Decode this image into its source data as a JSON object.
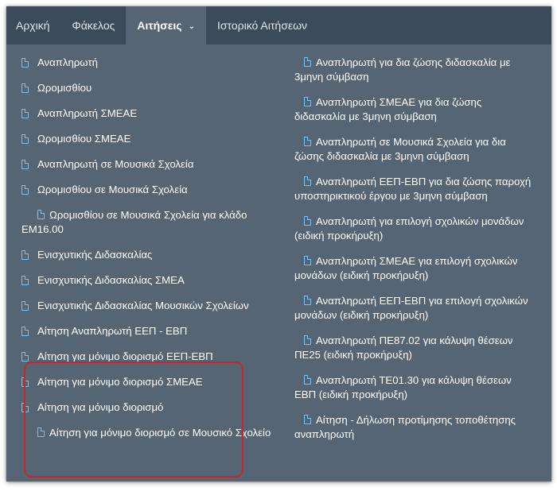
{
  "nav": {
    "items": [
      {
        "label": "Αρχική"
      },
      {
        "label": "Φάκελος"
      },
      {
        "label": "Αιτήσεις",
        "caret": "⌄"
      },
      {
        "label": "Ιστορικό Αιτήσεων"
      }
    ]
  },
  "menu": {
    "left": [
      "Αναπληρωτή",
      "Ωρομισθίου",
      "Αναπληρωτή ΣΜΕΑΕ",
      "Ωρομισθίου ΣΜΕΑΕ",
      "Αναπληρωτή σε Μουσικά Σχολεία",
      "Ωρομισθίου σε Μουσικά Σχολεία",
      "Ωρομισθίου σε Μουσικά Σχολεία για κλάδο ΕΜ16.00",
      "Ενισχυτικής Διδασκαλίας",
      "Ενισχυτικής Διδασκαλίας ΣΜΕΑ",
      "Ενισχυτικής Διδασκαλίας Μουσικών Σχολείων",
      "Αίτηση Αναπληρωτή ΕΕΠ - ΕΒΠ",
      "Αίτηση για μόνιμο διορισμό ΕΕΠ-ΕΒΠ",
      "Αίτηση για μόνιμο διορισμό ΣΜΕΑΕ",
      "Αίτηση για μόνιμο διορισμό",
      "Αίτηση για μόνιμο διορισμό σε Μουσικό Σχολείο"
    ],
    "right": [
      "Αναπληρωτή για δια ζώσης διδασκαλία με 3μηνη σύμβαση",
      "Αναπληρωτή ΣΜΕΑΕ για δια ζώσης διδασκαλία με 3μηνη σύμβαση",
      "Αναπληρωτή σε Μουσικά Σχολεία για δια ζώσης διδασκαλία με 3μηνη σύμβαση",
      "Αναπληρωτή ΕΕΠ-ΕΒΠ για δια ζώσης παροχή υποστηρικτικού έργου με 3μηνη σύμβαση",
      "Αναπληρωτή για επιλογή σχολικών μονάδων (ειδική προκήρυξη)",
      "Αναπληρωτή ΣΜΕΑΕ για επιλογή σχολικών μονάδων (ειδική προκήρυξη)",
      "Αναπληρωτή ΕΕΠ-ΕΒΠ για επιλογή σχολικών μονάδων (ειδική προκήρυξη)",
      "Αναπληρωτή ΠΕ87.02 για κάλυψη θέσεων ΠΕ25 (ειδική προκήρυξη)",
      "Αναπληρωτή ΤΕ01.30 για κάλυψη θέσεων ΕΒΠ (ειδική προκήρυξη)",
      "Αίτηση - Δήλωση προτίμησης τοποθέτησης αναπληρωτή"
    ]
  },
  "icons": {
    "menu_item": "document-icon"
  },
  "colors": {
    "navbar": "#3b4b5a",
    "panel": "#566573",
    "icon": "#7cc1ec",
    "highlight": "#c8252c"
  }
}
